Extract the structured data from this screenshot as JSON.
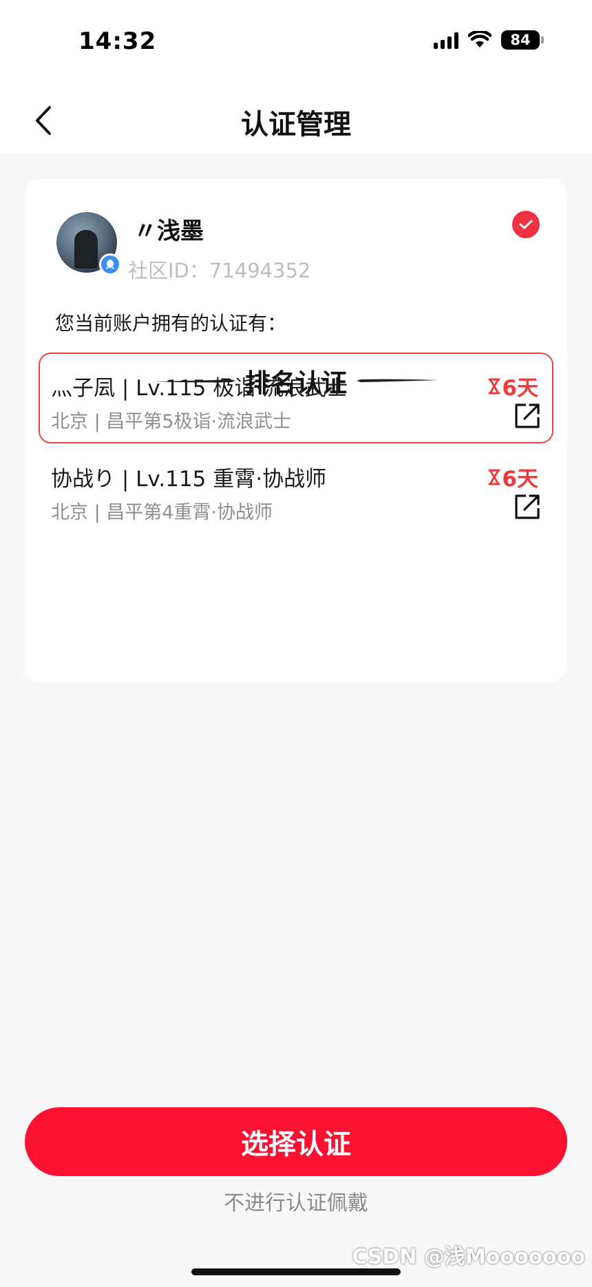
{
  "status_bar": {
    "time": "14:32",
    "battery": "84"
  },
  "nav": {
    "title": "认证管理"
  },
  "profile": {
    "name": "〃浅墨",
    "community_id": "社区ID：71494352"
  },
  "owned_label": "您当前账户拥有的认证有：",
  "section_title": "排名认证",
  "certifications": [
    {
      "title": "灬子凨 | Lv.115 极诣·流浪武士",
      "subtitle": "北京 | 昌平第5极诣·流浪武士",
      "days": "6天",
      "selected": true
    },
    {
      "title": "协战り | Lv.115 重霄·协战师",
      "subtitle": "北京 | 昌平第4重霄·协战师",
      "days": "6天",
      "selected": false
    }
  ],
  "primary_button": "选择认证",
  "skip_link": "不进行认证佩戴",
  "watermark": "CSDN @浅Mooooooo",
  "colors": {
    "accent": "#fb1131",
    "selected_border": "#e8423b",
    "days_text": "#f03a3a",
    "check_badge": "#f03043"
  }
}
